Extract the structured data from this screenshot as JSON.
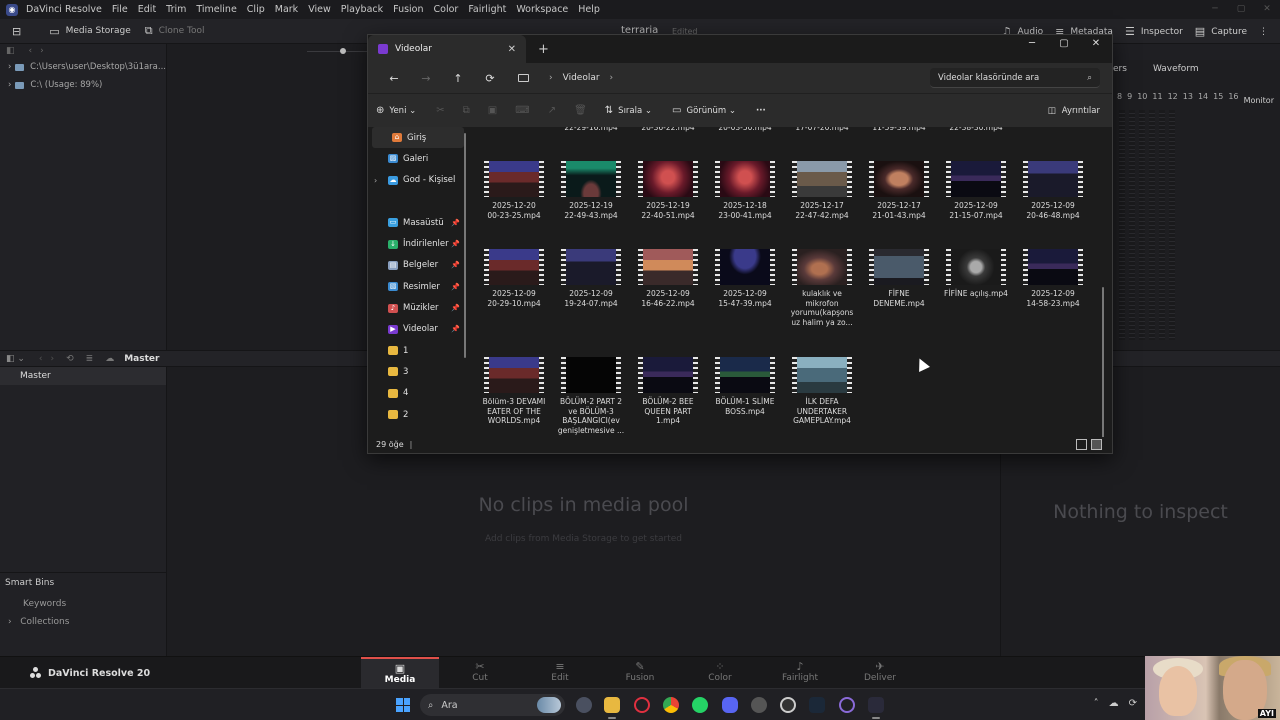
{
  "menubar": {
    "app_name": "DaVinci Resolve",
    "items": [
      "File",
      "Edit",
      "Trim",
      "Timeline",
      "Clip",
      "Mark",
      "View",
      "Playback",
      "Fusion",
      "Color",
      "Fairlight",
      "Workspace",
      "Help"
    ]
  },
  "toolbar": {
    "media_storage": "Media Storage",
    "clone_tool": "Clone Tool",
    "project_title": "terraria",
    "project_state": "Edited",
    "audio": "Audio",
    "metadata": "Metadata",
    "inspector": "Inspector",
    "capture": "Capture"
  },
  "media_storage": {
    "paths": [
      "C:\\Users\\user\\Desktop\\3ü1ara...",
      "C:\\ (Usage: 89%)"
    ]
  },
  "scopes": {
    "tab_partial": "ers",
    "waveform": "Waveform",
    "monitor": "Monitor",
    "scale": [
      "8",
      "9",
      "10",
      "11",
      "12",
      "13",
      "14",
      "15",
      "16"
    ]
  },
  "media_pool": {
    "bin_title": "Master",
    "master": "Master",
    "empty_title": "No clips in media pool",
    "empty_sub": "Add clips from Media Storage to get started",
    "smart_bins": "Smart Bins",
    "keywords": "Keywords",
    "collections": "Collections"
  },
  "inspector": {
    "empty": "Nothing to inspect"
  },
  "pages": {
    "brand": "DaVinci Resolve 20",
    "items": [
      {
        "label": "Media",
        "icon": "media-icon",
        "active": true
      },
      {
        "label": "Cut",
        "icon": "cut-icon",
        "active": false
      },
      {
        "label": "Edit",
        "icon": "edit-icon",
        "active": false
      },
      {
        "label": "Fusion",
        "icon": "fusion-icon",
        "active": false
      },
      {
        "label": "Color",
        "icon": "color-icon",
        "active": false
      },
      {
        "label": "Fairlight",
        "icon": "fairlight-icon",
        "active": false
      },
      {
        "label": "Deliver",
        "icon": "deliver-icon",
        "active": false
      }
    ]
  },
  "taskbar": {
    "search": "Ara",
    "webcam_tag": "AYI"
  },
  "explorer": {
    "tab_title": "Videolar",
    "breadcrumb": "Videolar",
    "search_placeholder": "Videolar klasöründe ara",
    "commands": {
      "new": "Yeni",
      "sort": "Sırala",
      "view": "Görünüm",
      "more": "···",
      "details": "Ayrıntılar"
    },
    "nav": [
      {
        "label": "Giriş",
        "icon": "home-icon",
        "color": "#e07a3a",
        "pin": false,
        "selected": true,
        "expand": false
      },
      {
        "label": "Galeri",
        "icon": "gallery-icon",
        "color": "#3a8ad0",
        "pin": false,
        "selected": false,
        "expand": false
      },
      {
        "label": "God - Kişisel",
        "icon": "onedrive-icon",
        "color": "#3a9ae0",
        "pin": false,
        "selected": false,
        "expand": true
      },
      {
        "label": "",
        "icon": "",
        "color": "",
        "pin": false,
        "selected": false,
        "expand": false
      },
      {
        "label": "Masaüstü",
        "icon": "desktop-icon",
        "color": "#3aa0e0",
        "pin": true,
        "selected": false,
        "expand": false
      },
      {
        "label": "İndirilenler",
        "icon": "downloads-icon",
        "color": "#2ab06a",
        "pin": true,
        "selected": false,
        "expand": false
      },
      {
        "label": "Belgeler",
        "icon": "documents-icon",
        "color": "#8aa0c0",
        "pin": true,
        "selected": false,
        "expand": false
      },
      {
        "label": "Resimler",
        "icon": "pictures-icon",
        "color": "#3a8ad0",
        "pin": true,
        "selected": false,
        "expand": false
      },
      {
        "label": "Müzikler",
        "icon": "music-icon",
        "color": "#d05050",
        "pin": true,
        "selected": false,
        "expand": false
      },
      {
        "label": "Videolar",
        "icon": "videos-icon",
        "color": "#7a3ad0",
        "pin": true,
        "selected": false,
        "expand": false
      },
      {
        "label": "1",
        "icon": "folder-icon",
        "color": "#e8b840",
        "pin": false,
        "selected": false,
        "expand": false
      },
      {
        "label": "3",
        "icon": "folder-icon",
        "color": "#e8b840",
        "pin": false,
        "selected": false,
        "expand": false
      },
      {
        "label": "4",
        "icon": "folder-icon",
        "color": "#e8b840",
        "pin": false,
        "selected": false,
        "expand": false
      },
      {
        "label": "2",
        "icon": "folder-icon",
        "color": "#e8b840",
        "pin": false,
        "selected": false,
        "expand": false
      }
    ],
    "top_row_partial": [
      "22-29-16.mp4",
      "20-36-22.mp4",
      "20-03-50.mp4",
      "17-07-20.mp4",
      "11-59-39.mp4",
      "22-38-30.mp4"
    ],
    "files": [
      {
        "name": "2025-12-20\n00-23-25.mp4",
        "scene": "terraria-red"
      },
      {
        "name": "2025-12-19\n22-49-43.mp4",
        "scene": "dark-aurora"
      },
      {
        "name": "2025-12-19\n22-40-51.mp4",
        "scene": "red-sky"
      },
      {
        "name": "2025-12-18\n23-00-41.mp4",
        "scene": "red-sky"
      },
      {
        "name": "2025-12-17\n22-47-42.mp4",
        "scene": "town"
      },
      {
        "name": "2025-12-17\n21-01-43.mp4",
        "scene": "person"
      },
      {
        "name": "2025-12-09\n21-15-07.mp4",
        "scene": "terraria-dark"
      },
      {
        "name": "2025-12-09\n20-46-48.mp4",
        "scene": "terraria-night"
      },
      {
        "name": "2025-12-09\n20-29-10.mp4",
        "scene": "terraria-red"
      },
      {
        "name": "2025-12-09\n19-24-07.mp4",
        "scene": "terraria-night"
      },
      {
        "name": "2025-12-09\n16-46-22.mp4",
        "scene": "sunset"
      },
      {
        "name": "2025-12-09\n15-47-39.mp4",
        "scene": "blue-arc"
      },
      {
        "name": "kulaklık ve\nmikrofon\nyorumu(kapşons\nuz halim ya zo...",
        "scene": "person2"
      },
      {
        "name": "FİFNE\nDENEME.mp4",
        "scene": "screen"
      },
      {
        "name": "FİFİNE açılış.mp4",
        "scene": "mic"
      },
      {
        "name": "2025-12-09\n14-58-23.mp4",
        "scene": "terraria-dark"
      },
      {
        "name": "Bölüm-3 DEVAMI\nEATER OF THE\nWORLDS.mp4",
        "scene": "terraria-red"
      },
      {
        "name": "BÖLÜM-2 PART 2\nve BÖLÜM-3\nBAŞLANGICI(ev\ngenişletmesive ...",
        "scene": "black"
      },
      {
        "name": "BÖLÜM-2 BEE\nQUEEN PART\n1.mp4",
        "scene": "terraria-dark"
      },
      {
        "name": "BÖLÜM-1 SLİME\nBOSS.mp4",
        "scene": "terraria-blue"
      },
      {
        "name": "İLK DEFA\nUNDERTAKER\nGAMEPLAY.mp4",
        "scene": "ice"
      }
    ],
    "status": "29 öğe"
  }
}
